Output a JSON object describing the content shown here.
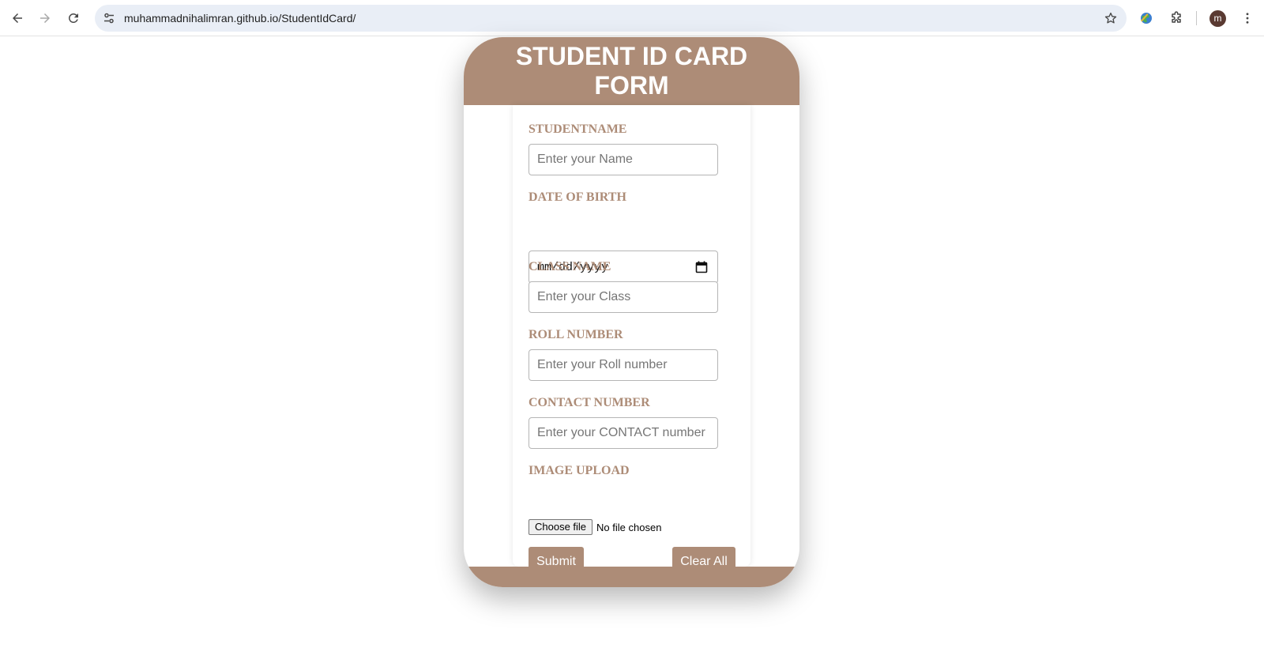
{
  "browser": {
    "url": "muhammadnihalimran.github.io/StudentIdCard/",
    "profile_initial": "m"
  },
  "colors": {
    "accent": "#ad8c77",
    "label": "#ad8c77",
    "button_text": "#ffffff"
  },
  "icons": {
    "back": "back-arrow-icon",
    "forward": "forward-arrow-icon",
    "reload": "reload-icon",
    "site_info": "tune-icon",
    "bookmark": "star-icon",
    "extension": "globe-icon",
    "extensions_menu": "puzzle-icon",
    "menu": "kebab-menu-icon",
    "calendar": "calendar-icon"
  },
  "form": {
    "title": "STUDENT ID CARD FORM",
    "student_name": {
      "label": "STUDENTNAME",
      "placeholder": "Enter your Name"
    },
    "dob": {
      "label": "DATE OF BIRTH",
      "value": "mm/dd/yyyy"
    },
    "class_name": {
      "label": "CLASS NAME",
      "placeholder": "Enter your Class"
    },
    "roll_number": {
      "label": "ROLL NUMBER",
      "placeholder": "Enter your Roll number"
    },
    "contact_number": {
      "label": "CONTACT NUMBER",
      "placeholder": "Enter your CONTACT number"
    },
    "image_upload": {
      "label": "IMAGE UPLOAD",
      "button": "Choose file",
      "status": "No file chosen"
    },
    "submit_label": "Submit",
    "clear_label": "Clear All"
  }
}
